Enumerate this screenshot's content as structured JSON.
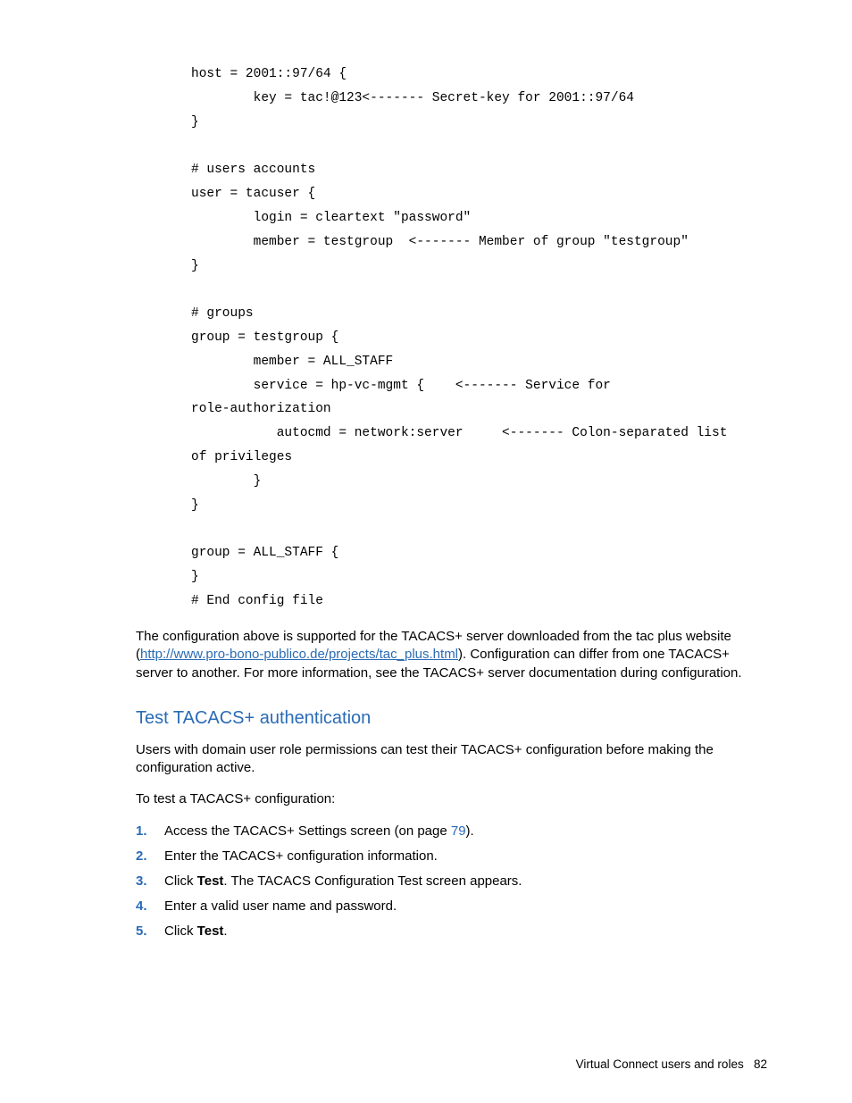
{
  "code": "host = 2001::97/64 {\n        key = tac!@123<------- Secret-key for 2001::97/64\n}\n\n# users accounts\nuser = tacuser {\n        login = cleartext \"password\"\n        member = testgroup  <------- Member of group \"testgroup\"\n}\n\n# groups\ngroup = testgroup {\n        member = ALL_STAFF\n        service = hp-vc-mgmt {    <------- Service for\nrole-authorization\n           autocmd = network:server     <------- Colon-separated list\nof privileges\n        }\n}\n\ngroup = ALL_STAFF {\n}\n# End config file",
  "para1_pre": "The configuration above is supported for the TACACS+ server downloaded from the tac plus website (",
  "para1_link": "http://www.pro-bono-publico.de/projects/tac_plus.html",
  "para1_post": "). Configuration can differ from one TACACS+ server to another. For more information, see the TACACS+ server documentation during configuration.",
  "heading": "Test TACACS+ authentication",
  "para2": "Users with domain user role permissions can test their TACACS+ configuration before making the configuration active.",
  "para3": "To test a TACACS+ configuration:",
  "steps": [
    {
      "num": "1.",
      "pre": "Access the TACACS+ Settings screen (on page ",
      "ref": "79",
      "post": ")."
    },
    {
      "num": "2.",
      "text": "Enter the TACACS+ configuration information."
    },
    {
      "num": "3.",
      "pre": "Click ",
      "bold": "Test",
      "post": ". The TACACS Configuration Test screen appears."
    },
    {
      "num": "4.",
      "text": "Enter a valid user name and password."
    },
    {
      "num": "5.",
      "pre": "Click ",
      "bold": "Test",
      "post": "."
    }
  ],
  "footer_text": "Virtual Connect users and roles",
  "footer_page": "82"
}
